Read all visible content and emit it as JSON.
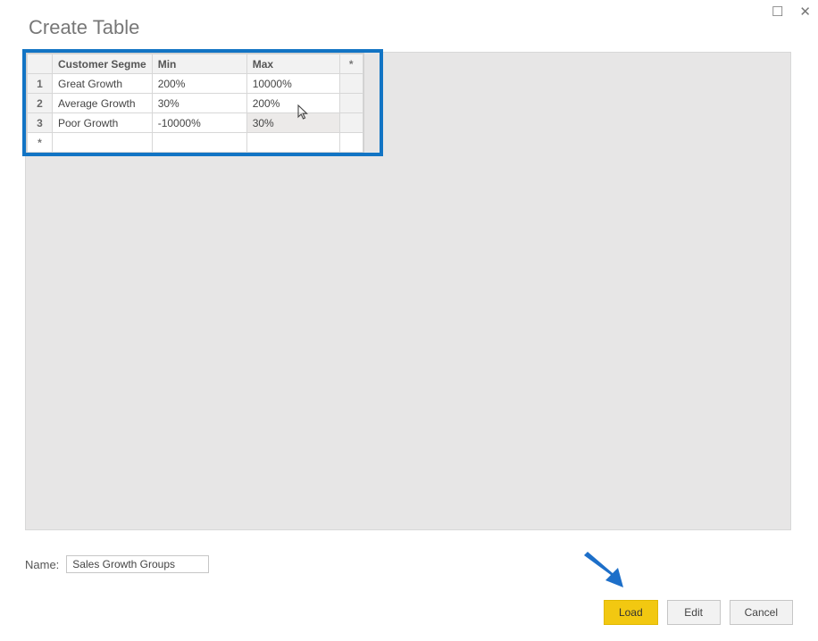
{
  "window": {
    "title": "Create Table"
  },
  "grid": {
    "columns": [
      "Customer Segme",
      "Min",
      "Max"
    ],
    "star_header": "*",
    "rows": [
      {
        "n": "1",
        "seg": "Great Growth",
        "min": "200%",
        "max": "10000%"
      },
      {
        "n": "2",
        "seg": "Average Growth",
        "min": "30%",
        "max": "200%"
      },
      {
        "n": "3",
        "seg": "Poor Growth",
        "min": "-10000%",
        "max": "30%"
      }
    ],
    "star_row": "*"
  },
  "name_field": {
    "label": "Name:",
    "value": "Sales Growth Groups"
  },
  "buttons": {
    "load": "Load",
    "edit": "Edit",
    "cancel": "Cancel"
  }
}
